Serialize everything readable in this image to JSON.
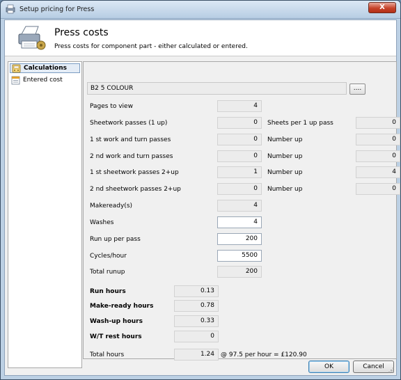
{
  "window": {
    "title": "Setup pricing for Press",
    "close_label": "X"
  },
  "header": {
    "title": "Press costs",
    "subtitle": "Press costs for component part - either calculated or entered."
  },
  "sidebar": {
    "items": [
      {
        "label": "Calculations",
        "selected": true
      },
      {
        "label": "Entered cost",
        "selected": false
      }
    ]
  },
  "part": {
    "name": "B2 5 COLOUR",
    "browse_label": "...."
  },
  "fields": {
    "pages_to_view": {
      "label": "Pages to view",
      "value": "4"
    },
    "sheetwork_passes": {
      "label": "Sheetwork passes (1 up)",
      "value": "0"
    },
    "work_turn_1": {
      "label": "1 st work and turn passes",
      "value": "0"
    },
    "work_turn_2": {
      "label": "2 nd work and turn passes",
      "value": "0"
    },
    "sheetwork_2up_1": {
      "label": "1 st sheetwork passes 2+up",
      "value": "1"
    },
    "sheetwork_2up_2": {
      "label": "2 nd sheetwork passes 2+up",
      "value": "0"
    },
    "makereadys": {
      "label": "Makeready(s)",
      "value": "4"
    },
    "washes": {
      "label": "Washes",
      "value": "4"
    },
    "run_up_per_pass": {
      "label": "Run up per pass",
      "value": "200"
    },
    "cycles_hour": {
      "label": "Cycles/hour",
      "value": "5500"
    },
    "total_runup": {
      "label": "Total runup",
      "value": "200"
    }
  },
  "right_fields": {
    "sheets_per_1up": {
      "label": "Sheets per 1 up pass",
      "value": "0"
    },
    "number_up_1": {
      "label": "Number up",
      "value": "0"
    },
    "number_up_2": {
      "label": "Number up",
      "value": "0"
    },
    "number_up_3": {
      "label": "Number up",
      "value": "4"
    },
    "number_up_4": {
      "label": "Number up",
      "value": "0"
    }
  },
  "hours": {
    "run_hours": {
      "label": "Run hours",
      "value": "0.13"
    },
    "make_ready_hours": {
      "label": "Make-ready hours",
      "value": "0.78"
    },
    "wash_up_hours": {
      "label": "Wash-up hours",
      "value": "0.33"
    },
    "wt_rest_hours": {
      "label": "W/T rest hours",
      "value": "0"
    },
    "total_hours": {
      "label": "Total hours",
      "value": "1.24",
      "rate_text": "@ 97.5 per hour = £120.90"
    }
  },
  "buttons": {
    "ok": "OK",
    "cancel": "Cancel"
  }
}
